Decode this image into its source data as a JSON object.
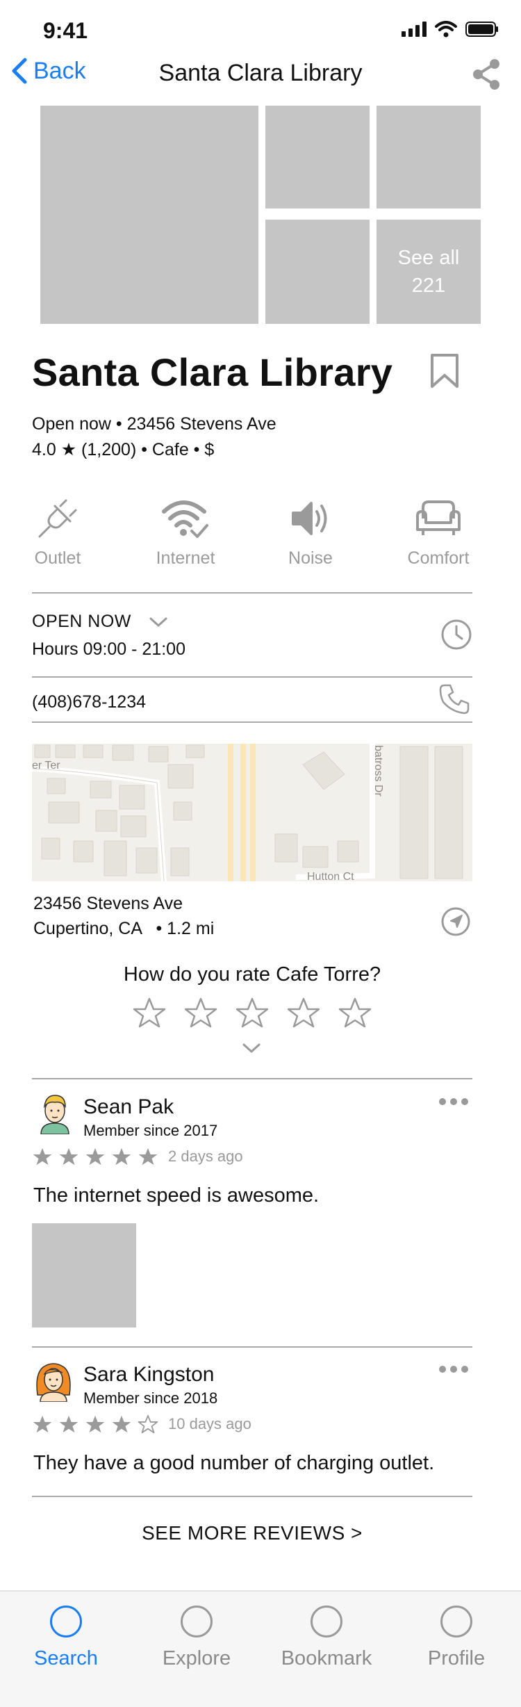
{
  "status": {
    "time": "9:41"
  },
  "nav": {
    "back_label": "Back",
    "title": "Santa Clara Library"
  },
  "photos": {
    "see_all_line1": "See all",
    "see_all_line2": "221"
  },
  "place": {
    "name": "Santa Clara Library",
    "line1": "Open now • 23456 Stevens Ave",
    "line2": "4.0 ★ (1,200) • Cafe • $"
  },
  "amenities": [
    {
      "label": "Outlet",
      "icon": "plug-icon"
    },
    {
      "label": "Internet",
      "icon": "wifi-check-icon"
    },
    {
      "label": "Noise",
      "icon": "speaker-icon"
    },
    {
      "label": "Comfort",
      "icon": "armchair-icon"
    }
  ],
  "hours": {
    "status": "OPEN NOW",
    "hours": "Hours 09:00 - 21:00"
  },
  "phone": "(408)678-1234",
  "map": {
    "street1": "er Ter",
    "street2": "batross Dr",
    "street3": "Hutton Ct"
  },
  "address": {
    "line1": "23456 Stevens Ave",
    "line2": "Cupertino, CA   • 1.2 mi"
  },
  "rating_prompt": {
    "question": "How do you rate Cafe Torre?"
  },
  "reviews": [
    {
      "name": "Sean Pak",
      "member": "Member since 2017",
      "stars": 5,
      "date": "2 days ago",
      "text": "The internet speed is awesome."
    },
    {
      "name": "Sara Kingston",
      "member": "Member since 2018",
      "stars": 4,
      "date": "10 days ago",
      "text": "They have a good number of charging outlet."
    }
  ],
  "see_more": "SEE MORE REVIEWS >",
  "tabs": [
    {
      "label": "Search",
      "active": true
    },
    {
      "label": "Explore",
      "active": false
    },
    {
      "label": "Bookmark",
      "active": false
    },
    {
      "label": "Profile",
      "active": false
    }
  ],
  "colors": {
    "accent": "#1a7ef0",
    "grey": "#9a9a9a",
    "photo": "#c5c5c5"
  }
}
